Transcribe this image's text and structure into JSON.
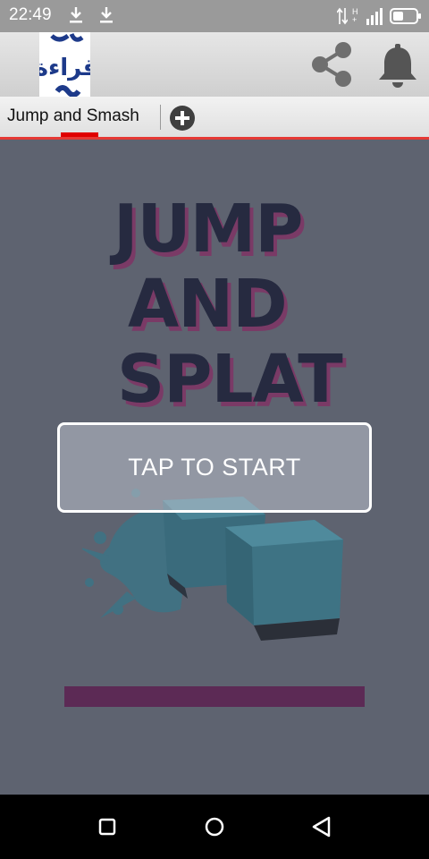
{
  "status_bar": {
    "time": "22:49",
    "icons": [
      "download-icon",
      "download-icon",
      "data-arrows-icon",
      "hplus-icon",
      "signal-icon",
      "battery-icon"
    ],
    "network_label": "H+"
  },
  "header": {
    "logo_text": "قراءة",
    "share_icon": "share-icon",
    "bell_icon": "bell-icon"
  },
  "tabs": [
    {
      "label": "Jump and Smash",
      "active": true
    }
  ],
  "add_tab_icon": "add-circle-icon",
  "game": {
    "title_lines": [
      "JUMP",
      "AND",
      "SPLAT"
    ],
    "start_label": "TAP TO START",
    "colors": {
      "background": "#5e6370",
      "title": "#262a40",
      "title_shadow": "#7a3a66",
      "cube": "#3e7384",
      "progress_bar": "#5c2a55",
      "accent": "#e53935"
    }
  },
  "nav_bar": {
    "icons": [
      "square-recents-icon",
      "circle-home-icon",
      "triangle-back-icon"
    ]
  }
}
